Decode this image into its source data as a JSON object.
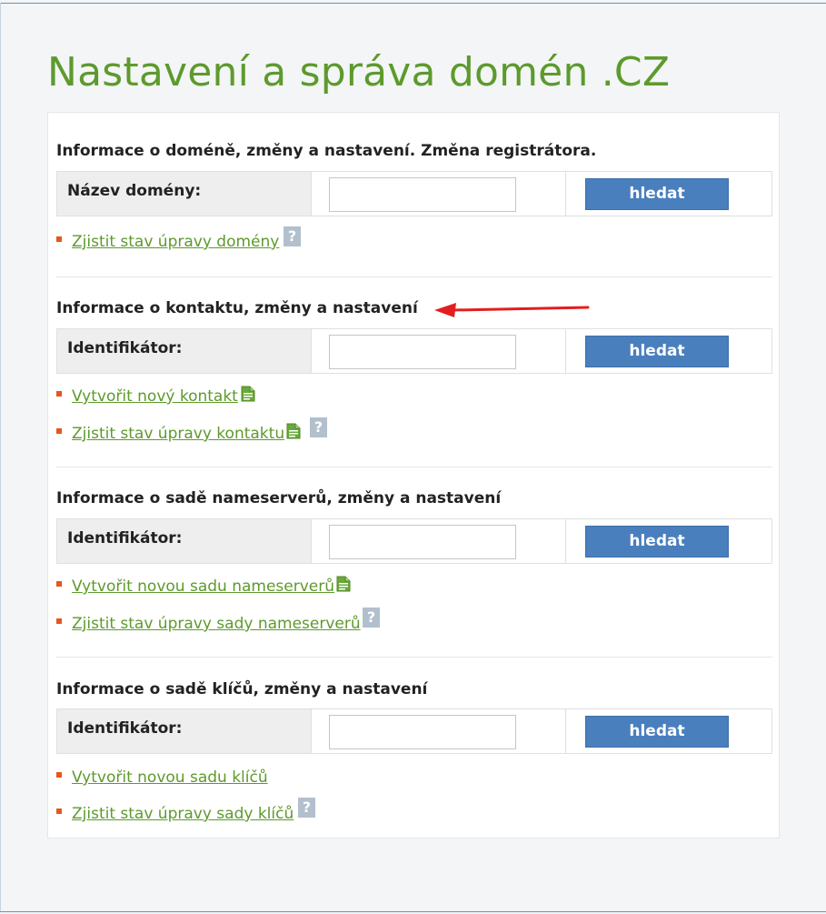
{
  "page": {
    "title": "Nastavení a správa domén .CZ"
  },
  "colors": {
    "title_green": "#5d9a2c",
    "link_green": "#5d9a2c",
    "button_blue": "#4a7fbe",
    "bullet_orange": "#e8561c",
    "label_cell_gray": "#eeeeee",
    "annotation_red": "#e31e1e"
  },
  "sections": [
    {
      "title": "Informace o doméně, změny a nastavení. Změna registrátora.",
      "search_label": "Název domény:",
      "input_value": "",
      "button_label": "hledat",
      "links": [
        {
          "label": "Zjistit stav úpravy domény",
          "icons": [
            "help-icon"
          ]
        }
      ]
    },
    {
      "title": "Informace o kontaktu, změny a nastavení",
      "search_label": "Identifikátor:",
      "input_value": "",
      "button_label": "hledat",
      "links": [
        {
          "label": "Vytvořit nový kontakt",
          "icons": [
            "document-icon"
          ]
        },
        {
          "label": "Zjistit stav úpravy kontaktu",
          "icons": [
            "document-icon",
            "help-icon"
          ]
        }
      ]
    },
    {
      "title": "Informace o sadě nameserverů, změny a nastavení",
      "search_label": "Identifikátor:",
      "input_value": "",
      "button_label": "hledat",
      "links": [
        {
          "label": "Vytvořit novou sadu nameserverů",
          "icons": [
            "document-icon"
          ]
        },
        {
          "label": "Zjistit stav úpravy sady nameserverů",
          "icons": [
            "help-icon"
          ]
        }
      ]
    },
    {
      "title": "Informace o sadě klíčů, změny a nastavení",
      "search_label": "Identifikátor:",
      "input_value": "",
      "button_label": "hledat",
      "links": [
        {
          "label": "Vytvořit novou sadu klíčů",
          "icons": []
        },
        {
          "label": "Zjistit stav úpravy sady klíčů",
          "icons": [
            "help-icon"
          ]
        }
      ]
    }
  ],
  "help_icon_glyph": "?",
  "annotation": {
    "icon": "red-arrow-icon",
    "points_to": "sections.1.title"
  }
}
